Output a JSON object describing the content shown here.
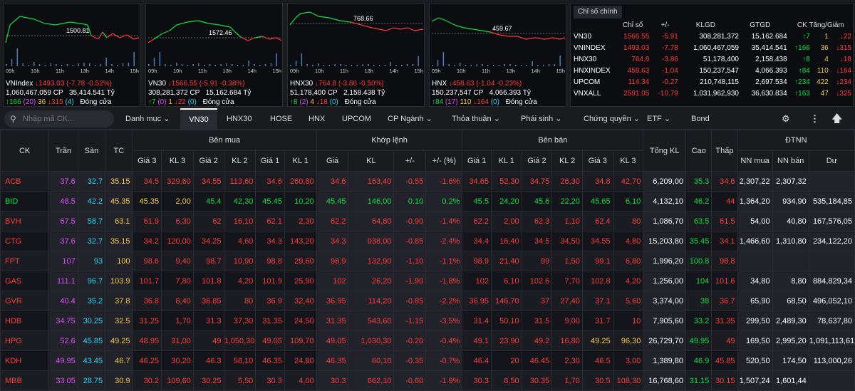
{
  "mini_charts": [
    {
      "name": "VNIndex",
      "ref_value": "1500.81",
      "times": [
        "09h",
        "10h",
        "11h",
        "13h",
        "14h",
        "15h"
      ],
      "line1": {
        "name": "VNIndex",
        "change": "↓1493.03 (-7.78 -0.52%)"
      },
      "line2": {
        "volume": "1,060,467,059 CP",
        "value": "35,414.541 Tỷ"
      },
      "line3": {
        "up": "↑166",
        "ceiling": "(20)",
        "ref": "36",
        "down": "↓315",
        "floor": "(4)",
        "status": "Đóng cửa"
      }
    },
    {
      "name": "VN30",
      "ref_value": "1572.46",
      "times": [
        "09h",
        "10h",
        "11h",
        "13h",
        "14h",
        "15h"
      ],
      "line1": {
        "name": "VN30",
        "change": "↓1566.55 (-5.91 -0.38%)"
      },
      "line2": {
        "volume": "308,281,372 CP",
        "value": "15,162.684 Tỷ"
      },
      "line3": {
        "up": "↑7",
        "ceiling": "(0)",
        "ref": "1",
        "down": "↓22",
        "floor": "(0)",
        "status": "Đóng cửa"
      }
    },
    {
      "name": "HNX30",
      "ref_value": "768.66",
      "times": [
        "09h",
        "10h",
        "11h",
        "13h",
        "14h",
        "15h"
      ],
      "line1": {
        "name": "HNX30",
        "change": "↓764.8 (-3.86 -0.50%)"
      },
      "line2": {
        "volume": "51,178,400 CP",
        "value": "2,158.438 Tỷ"
      },
      "line3": {
        "up": "↑8",
        "ceiling": "(2)",
        "ref": "4",
        "down": "↓18",
        "floor": "(0)",
        "status": "Đóng cửa"
      }
    },
    {
      "name": "HNX",
      "ref_value": "459.67",
      "times": [
        "09h",
        "10h",
        "11h",
        "13h",
        "14h",
        "15h"
      ],
      "line1": {
        "name": "HNX",
        "change": "↓458.63 (-1.04 -0.23%)"
      },
      "line2": {
        "volume": "150,237,547 CP",
        "value": "4,066.393 Tỷ"
      },
      "line3": {
        "up": "↑84",
        "ceiling": "(17)",
        "ref": "110",
        "down": "↓164",
        "floor": "(0)",
        "status": "Đóng cửa"
      }
    }
  ],
  "stats": {
    "tab": "Chỉ số chính",
    "headers": [
      "Chỉ số",
      "+/-",
      "KLGD",
      "GTGD",
      "CK Tăng/Giảm"
    ],
    "rows": [
      {
        "name": "VN30",
        "value": "1566.55",
        "change": "-5.91",
        "vol": "308,281,372",
        "val": "15,162.684",
        "up": "↑7",
        "ref": "1",
        "down": "↓22"
      },
      {
        "name": "VNINDEX",
        "value": "1493.03",
        "change": "-7.78",
        "vol": "1,060,467,059",
        "val": "35,414.541",
        "up": "↑166",
        "ref": "36",
        "down": "↓315"
      },
      {
        "name": "HNX30",
        "value": "764.8",
        "change": "-3.86",
        "vol": "51,178,400",
        "val": "2,158.438",
        "up": "↑8",
        "ref": "4",
        "down": "↓18"
      },
      {
        "name": "HNXINDEX",
        "value": "458.63",
        "change": "-1.04",
        "vol": "150,237,547",
        "val": "4,066.393",
        "up": "↑84",
        "ref": "110",
        "down": "↓164"
      },
      {
        "name": "UPCOM",
        "value": "114.34",
        "change": "-0.27",
        "vol": "210,748,115",
        "val": "2,697.534",
        "up": "↑234",
        "ref": "422",
        "down": "↓234"
      },
      {
        "name": "VNXALL",
        "value": "2591.05",
        "change": "-10.79",
        "vol": "1,031,962,930",
        "val": "36,630.834",
        "up": "↑163",
        "ref": "47",
        "down": "↓325"
      }
    ]
  },
  "nav": {
    "search_placeholder": "Nhập mã CK...",
    "items": [
      "Danh mục ⌄",
      "VN30",
      "HNX30",
      "HOSE",
      "HNX",
      "UPCOM",
      "CP Ngành ⌄",
      "Thỏa thuận ⌄",
      "Phái sinh ⌄",
      "Chứng quyền ⌄",
      "ETF ⌄",
      "Bond"
    ]
  },
  "table": {
    "groups": [
      "Bên mua",
      "Khớp lệnh",
      "Bên bán",
      "ĐTNN"
    ],
    "top_headers": [
      "CK",
      "Trần",
      "Sàn",
      "TC",
      "Tổng KL",
      "Cao",
      "Thấp"
    ],
    "sub_headers": [
      "Giá 3",
      "KL 3",
      "Giá 2",
      "KL 2",
      "Giá 1",
      "KL 1",
      "Giá",
      "KL",
      "+/-",
      "+/- (%)",
      "Giá 1",
      "KL 1",
      "Giá 2",
      "KL 2",
      "Giá 3",
      "KL 3",
      "NN mua",
      "NN bán",
      "Dư"
    ],
    "rows": [
      [
        "ACB",
        "37.6",
        "32.7",
        "35.15",
        "34.5",
        "329,60",
        "34.55",
        "113,60",
        "34.6",
        "260,80",
        "34.6",
        "163,40",
        "-0.55",
        "-1.6%",
        "34.65",
        "52,30",
        "34.75",
        "26,30",
        "34.8",
        "42,70",
        "6,209,00",
        "35.3",
        "34.6",
        "2,307,22",
        "2,307,32",
        ""
      ],
      [
        "BID",
        "48.5",
        "42.2",
        "45.35",
        "45.35",
        "2,00",
        "45.4",
        "42,30",
        "45.45",
        "10,20",
        "45.45",
        "146,00",
        "0.10",
        "0.2%",
        "45.5",
        "24,20",
        "45.6",
        "22,20",
        "45.65",
        "6,10",
        "4,132,10",
        "46.2",
        "44",
        "1,364,20",
        "934,90",
        "535,184,85"
      ],
      [
        "BVH",
        "67.5",
        "58.7",
        "63.1",
        "61.9",
        "6,30",
        "62",
        "16,10",
        "62.1",
        "2,30",
        "62.2",
        "64,80",
        "-0.90",
        "-1.4%",
        "62.2",
        "2,00",
        "62.3",
        "1,10",
        "62.4",
        "80",
        "1,086,70",
        "63.5",
        "61.5",
        "54,00",
        "40,80",
        "167,576,05"
      ],
      [
        "CTG",
        "37.6",
        "32.7",
        "35.15",
        "34.2",
        "120,00",
        "34.25",
        "4,60",
        "34.3",
        "143,20",
        "34.3",
        "938,00",
        "-0.85",
        "-2.4%",
        "34.4",
        "16,40",
        "34.5",
        "34,50",
        "34.55",
        "4,80",
        "15,203,80",
        "35.45",
        "34.1",
        "1,466,60",
        "1,310,80",
        "234,122,20"
      ],
      [
        "FPT",
        "107",
        "93",
        "100",
        "98.6",
        "9,40",
        "98.7",
        "10,90",
        "98.8",
        "29,60",
        "98.9",
        "132,90",
        "-1.10",
        "-1.1%",
        "98.9",
        "21,40",
        "99",
        "1,50",
        "99.1",
        "6,80",
        "1,996,20",
        "100.8",
        "98.8",
        "",
        "",
        ""
      ],
      [
        "GAS",
        "111.1",
        "96.7",
        "103.9",
        "101.7",
        "7,80",
        "101.8",
        "4,20",
        "101.9",
        "25,90",
        "102",
        "26,20",
        "-1.90",
        "-1.8%",
        "102",
        "6,10",
        "102.6",
        "7,70",
        "102.8",
        "4,20",
        "1,256,00",
        "104",
        "101.6",
        "34,80",
        "8,80",
        "884,829,34"
      ],
      [
        "GVR",
        "40.4",
        "35.2",
        "37.8",
        "36.8",
        "8,40",
        "36.85",
        "80",
        "36.9",
        "32,40",
        "36.95",
        "114,20",
        "-0.85",
        "-2.2%",
        "36.95",
        "146,70",
        "37",
        "27,40",
        "37.1",
        "5,60",
        "3,374,00",
        "38",
        "36.7",
        "65,90",
        "68,50",
        "496,052,10"
      ],
      [
        "HDB",
        "34.75",
        "30.25",
        "32.5",
        "31.25",
        "1,70",
        "31.3",
        "37,30",
        "31.35",
        "24,50",
        "31.35",
        "543,60",
        "-1.15",
        "-3.5%",
        "31.4",
        "50,10",
        "31.5",
        "9,00",
        "31.7",
        "10",
        "7,905,60",
        "33.2",
        "31.35",
        "299,50",
        "2,489,30",
        "78,637,80"
      ],
      [
        "HPG",
        "52.6",
        "45.85",
        "49.25",
        "48.95",
        "31,00",
        "49",
        "1,050,30",
        "49.05",
        "109,70",
        "49.05",
        "1,030,30",
        "-0.20",
        "-0.4%",
        "49.1",
        "23,90",
        "49.2",
        "16,80",
        "49.25",
        "96,30",
        "26,729,70",
        "49.95",
        "49",
        "169,50",
        "2,995,20",
        "1,091,113,61"
      ],
      [
        "KDH",
        "49.95",
        "43.45",
        "46.7",
        "46.25",
        "30,20",
        "46.3",
        "58,10",
        "46.35",
        "24,80",
        "46.35",
        "60,10",
        "-0.35",
        "-0.7%",
        "46.4",
        "20",
        "46.45",
        "2,30",
        "46.5",
        "3,00",
        "1,389,80",
        "46.9",
        "45.85",
        "520,50",
        "174,50",
        "113,000,26"
      ],
      [
        "MBB",
        "33.05",
        "28.75",
        "30.9",
        "30.2",
        "109,60",
        "30.25",
        "5,50",
        "30.3",
        "4,00",
        "30.3",
        "662,10",
        "-0.60",
        "-1.9%",
        "30.3",
        "8,50",
        "30.35",
        "1,70",
        "30.5",
        "108,30",
        "16,768,60",
        "31.15",
        "30.15",
        "1,507,24",
        "1,601,44",
        ""
      ]
    ]
  }
}
